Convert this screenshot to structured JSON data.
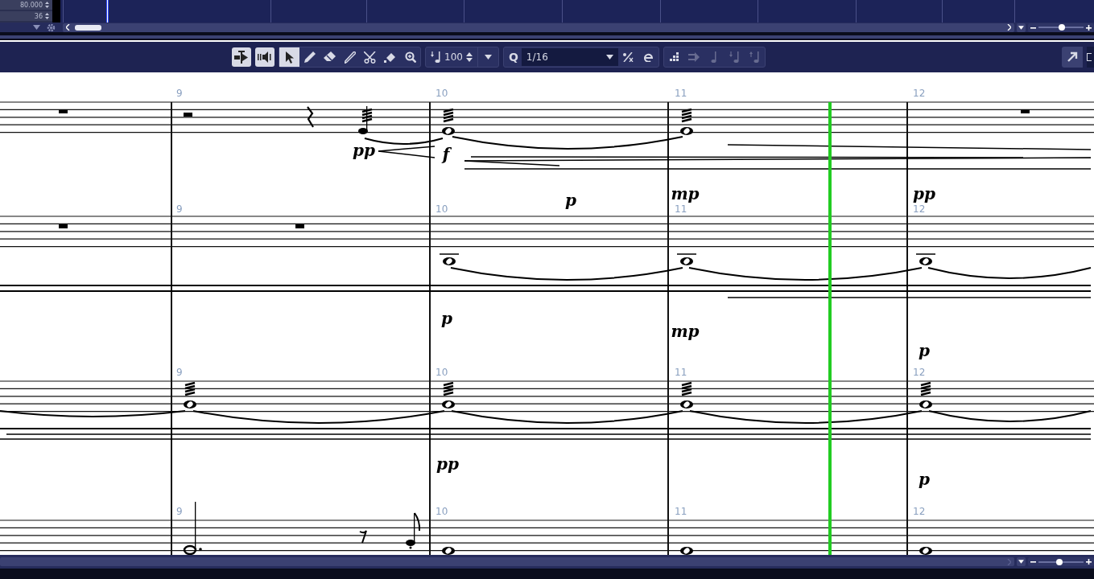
{
  "inspector": {
    "fields": [
      "80.000",
      "36"
    ]
  },
  "toolbar": {
    "mode_buttons": [
      {
        "kind": "solo-lane",
        "on": true
      },
      {
        "kind": "speaker",
        "on": true
      }
    ],
    "tools": [
      {
        "kind": "pointer",
        "selected": true
      },
      {
        "kind": "pencil",
        "selected": false
      },
      {
        "kind": "eraser",
        "selected": false
      },
      {
        "kind": "trim",
        "selected": false
      },
      {
        "kind": "scissors",
        "selected": false
      },
      {
        "kind": "glue",
        "selected": false
      },
      {
        "kind": "zoom",
        "selected": false
      }
    ],
    "velocity": "100",
    "quantize_label": "Q",
    "quantize": "1/16",
    "note_tools": [
      {
        "kind": "bars",
        "disabled": false
      },
      {
        "kind": "move",
        "disabled": true
      },
      {
        "kind": "note",
        "disabled": true
      },
      {
        "kind": "note-down",
        "disabled": true
      },
      {
        "kind": "note-up",
        "disabled": true
      }
    ]
  },
  "score": {
    "systems": [
      {
        "measure_numbers": [
          "9",
          "10",
          "11",
          "12"
        ],
        "dynamics": [
          "pp",
          "f"
        ]
      },
      {
        "measure_numbers": [
          "9",
          "10",
          "11",
          "12"
        ],
        "dynamics": [
          "p",
          "mp",
          "pp",
          "p",
          "mp",
          "p"
        ]
      },
      {
        "measure_numbers": [
          "9",
          "10",
          "11",
          "12"
        ],
        "dynamics": [
          "pp",
          "p"
        ]
      },
      {
        "measure_numbers": [
          "9",
          "10",
          "11",
          "12"
        ]
      }
    ]
  },
  "zoom_sliders": [
    {
      "level": 0.52
    },
    {
      "level": 0.46
    }
  ]
}
